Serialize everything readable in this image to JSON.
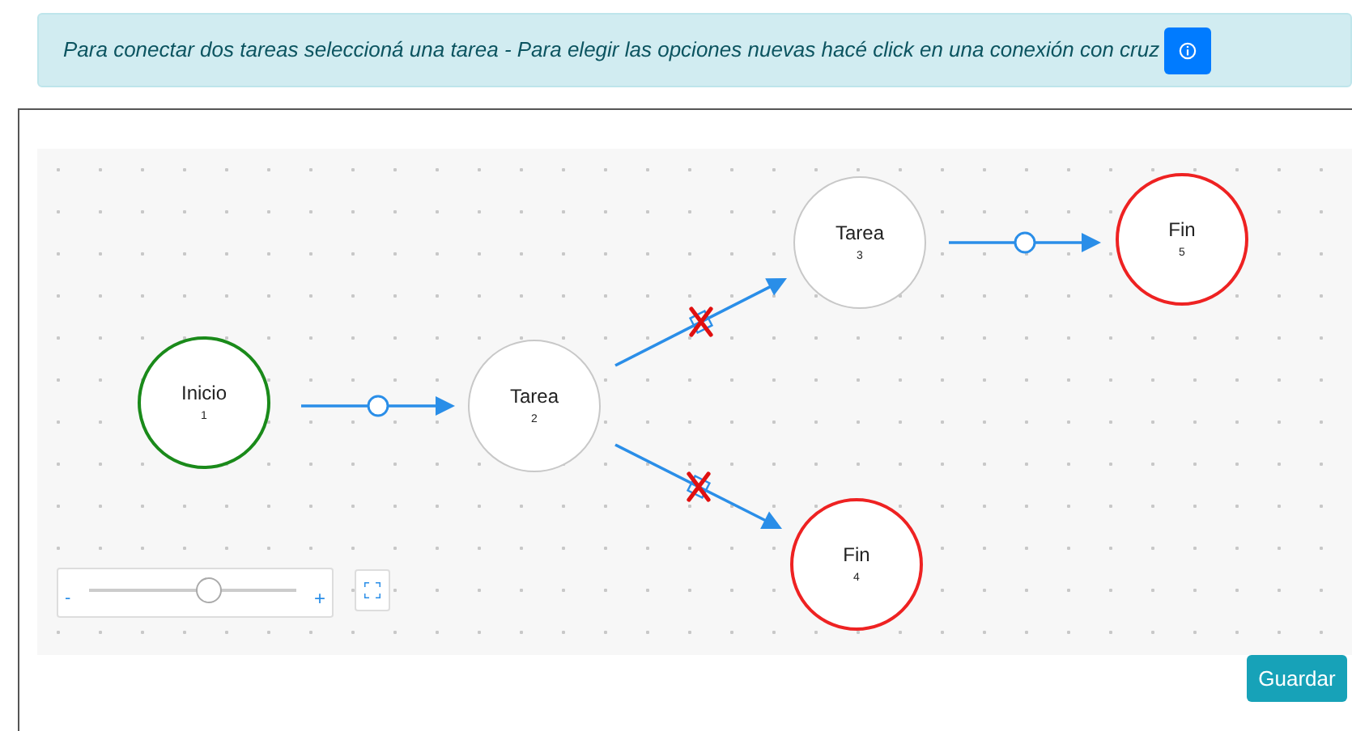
{
  "alert": {
    "text": "Para conectar dos tareas seleccioná una tarea - Para elegir las opciones nuevas hacé click en una conexión con cruz"
  },
  "diagram": {
    "nodes": [
      {
        "kind": "start",
        "label": "Inicio",
        "number": "1"
      },
      {
        "kind": "task",
        "label": "Tarea",
        "number": "2"
      },
      {
        "kind": "task",
        "label": "Tarea",
        "number": "3"
      },
      {
        "kind": "end",
        "label": "Fin",
        "number": "5"
      },
      {
        "kind": "end",
        "label": "Fin",
        "number": "4"
      }
    ],
    "edges": [
      {
        "kind": "handle"
      },
      {
        "kind": "cross"
      },
      {
        "kind": "cross"
      },
      {
        "kind": "handle"
      }
    ],
    "zoom": {
      "minus": "-",
      "plus": "+",
      "level": 0.58
    }
  },
  "save_button": "Guardar"
}
